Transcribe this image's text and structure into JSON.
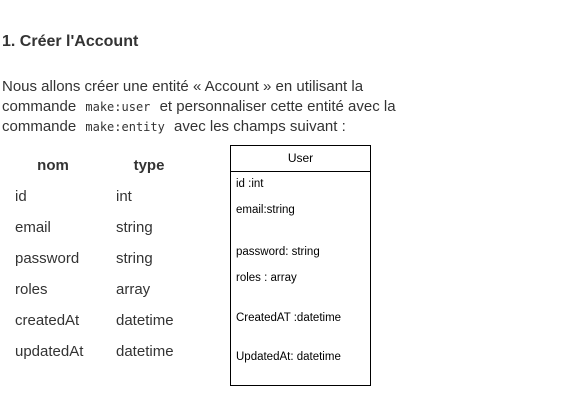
{
  "heading": "1. Créer l'Account",
  "paragraph": {
    "line1": "Nous allons créer une entité « Account » en utilisant la",
    "line2_prefix": "commande",
    "line2_code": "make:user",
    "line2_suffix": "et personnaliser cette entité avec la",
    "line3_prefix": "commande",
    "line3_code": "make:entity",
    "line3_suffix": "avec les champs suivant :"
  },
  "table": {
    "headers": [
      "nom",
      "type"
    ],
    "rows": [
      [
        "id",
        "int"
      ],
      [
        "email",
        "string"
      ],
      [
        "password",
        "string"
      ],
      [
        "roles",
        "array"
      ],
      [
        "createdAt",
        "datetime"
      ],
      [
        "updatedAt",
        "datetime"
      ]
    ]
  },
  "user_box": {
    "title": "User",
    "attributes": [
      "id :int",
      "email:string",
      "password: string",
      "roles : array",
      "CreatedAT :datetime",
      "UpdatedAt: datetime"
    ]
  }
}
